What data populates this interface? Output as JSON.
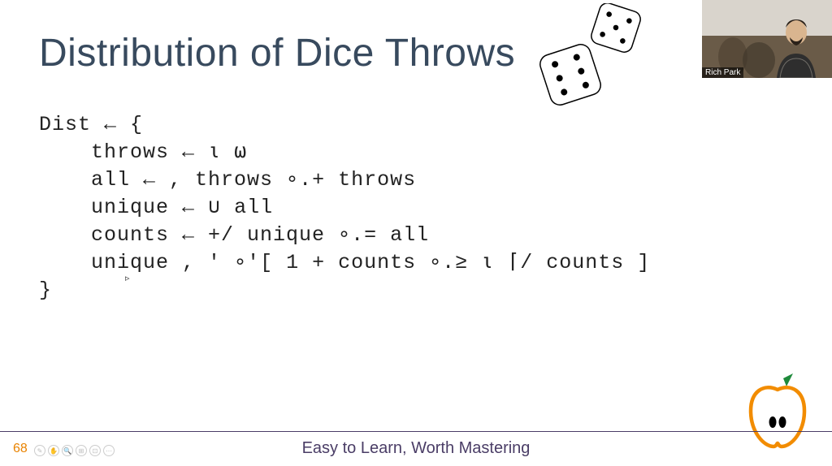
{
  "title": "Distribution of Dice Throws",
  "code_lines": [
    "Dist ← {",
    "    throws ← ⍳ ⍵",
    "    all ← , throws ∘.+ throws",
    "    unique ← ∪ all",
    "    counts ← +/ unique ∘.= all",
    "    unique , ' ∘'[ 1 + counts ∘.≥ ⍳ ⌈/ counts ]",
    "}"
  ],
  "webcam_name": "Rich Park",
  "page_number": "68",
  "tagline": "Easy to Learn, Worth Mastering",
  "controls": [
    "✎",
    "✋",
    "🔍",
    "⊞",
    "⊡",
    "⋯"
  ],
  "cursor": "▹",
  "logo_color": "#f28c00",
  "leaf_color": "#1e8a3b"
}
